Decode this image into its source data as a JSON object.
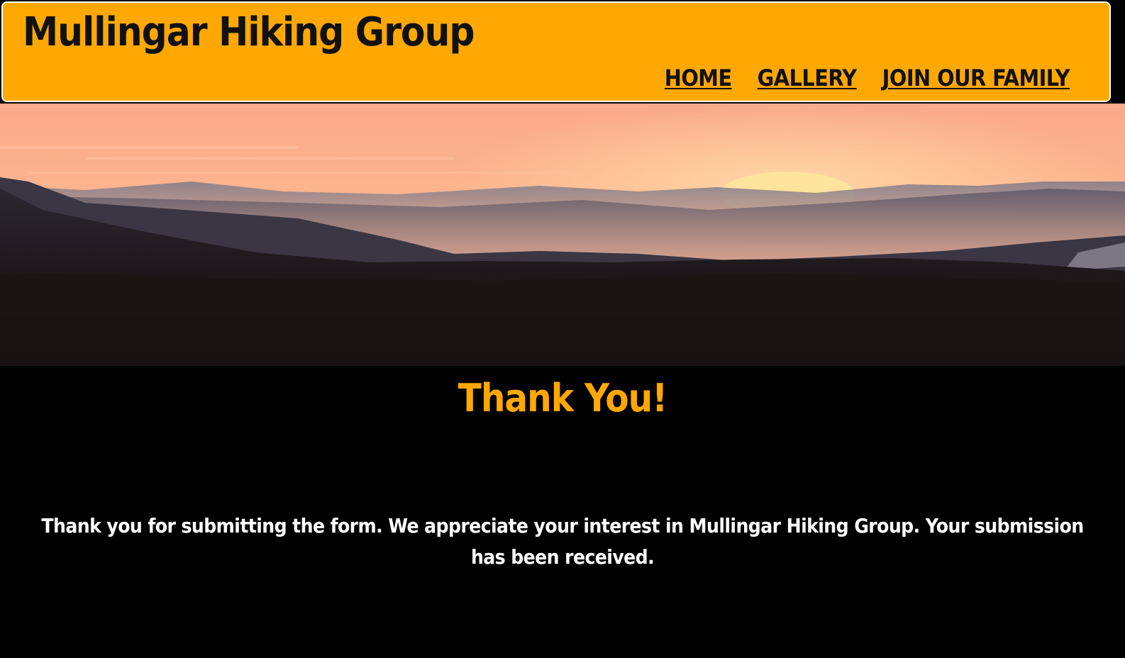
{
  "header": {
    "title": "Mullingar Hiking Group",
    "nav": [
      {
        "label": "HOME"
      },
      {
        "label": "GALLERY"
      },
      {
        "label": "JOIN OUR FAMILY"
      }
    ]
  },
  "hero": {
    "image": "mountain-sunset-landscape"
  },
  "main": {
    "heading": "Thank You!",
    "message": "Thank you for submitting the form. We appreciate your interest in Mullingar Hiking Group. Your submission has been received."
  },
  "colors": {
    "accent": "#ffa801",
    "background": "#000000",
    "text": "#ffffff",
    "header_text": "#111111"
  }
}
